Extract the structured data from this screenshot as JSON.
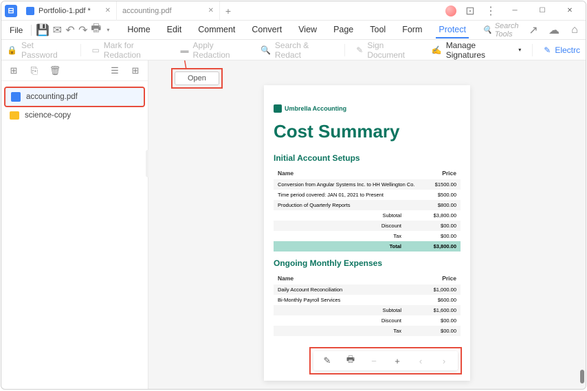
{
  "titlebar": {
    "tabs": [
      {
        "label": "Portfolio-1.pdf *"
      },
      {
        "label": "accounting.pdf"
      }
    ]
  },
  "menubar": {
    "file": "File",
    "items": [
      "Home",
      "Edit",
      "Comment",
      "Convert",
      "View",
      "Page",
      "Tool",
      "Form",
      "Protect"
    ],
    "active": "Protect",
    "search_placeholder": "Search Tools"
  },
  "toolbar": {
    "set_password": "Set Password",
    "mark_redaction": "Mark for Redaction",
    "apply_redaction": "Apply Redaction",
    "search_redact": "Search & Redact",
    "sign_document": "Sign Document",
    "manage_signatures": "Manage Signatures",
    "electric": "Electrc"
  },
  "sidebar": {
    "items": [
      {
        "name": "accounting.pdf",
        "type": "pdf",
        "selected": true
      },
      {
        "name": "science-copy",
        "type": "folder",
        "selected": false
      }
    ]
  },
  "open_button": "Open",
  "document": {
    "brand": "Umbrella Accounting",
    "title": "Cost Summary",
    "section1": {
      "title": "Initial Account Setups",
      "header_name": "Name",
      "header_price": "Price",
      "rows": [
        {
          "name": "Conversion from Angular Systems Inc. to HH Wellington Co.",
          "price": "$1500.00"
        },
        {
          "name": "Time period covered: JAN 01, 2021 to Present",
          "price": "$500.00"
        },
        {
          "name": "Production of Quarterly Reports",
          "price": "$800.00"
        }
      ],
      "summary": [
        {
          "label": "Subtotal",
          "value": "$3,800.00"
        },
        {
          "label": "Discount",
          "value": "$00.00"
        },
        {
          "label": "Tax",
          "value": "$00.00"
        },
        {
          "label": "Total",
          "value": "$3,800.00"
        }
      ]
    },
    "section2": {
      "title": "Ongoing Monthly Expenses",
      "header_name": "Name",
      "header_price": "Price",
      "rows": [
        {
          "name": "Daily Account Reconciliation",
          "price": "$1,000.00"
        },
        {
          "name": "Bi-Monthly Payroll Services",
          "price": "$600.00"
        }
      ],
      "summary": [
        {
          "label": "Subtotal",
          "value": "$1,600.00"
        },
        {
          "label": "Discount",
          "value": "$00.00"
        },
        {
          "label": "Tax",
          "value": "$00.00"
        }
      ]
    }
  }
}
